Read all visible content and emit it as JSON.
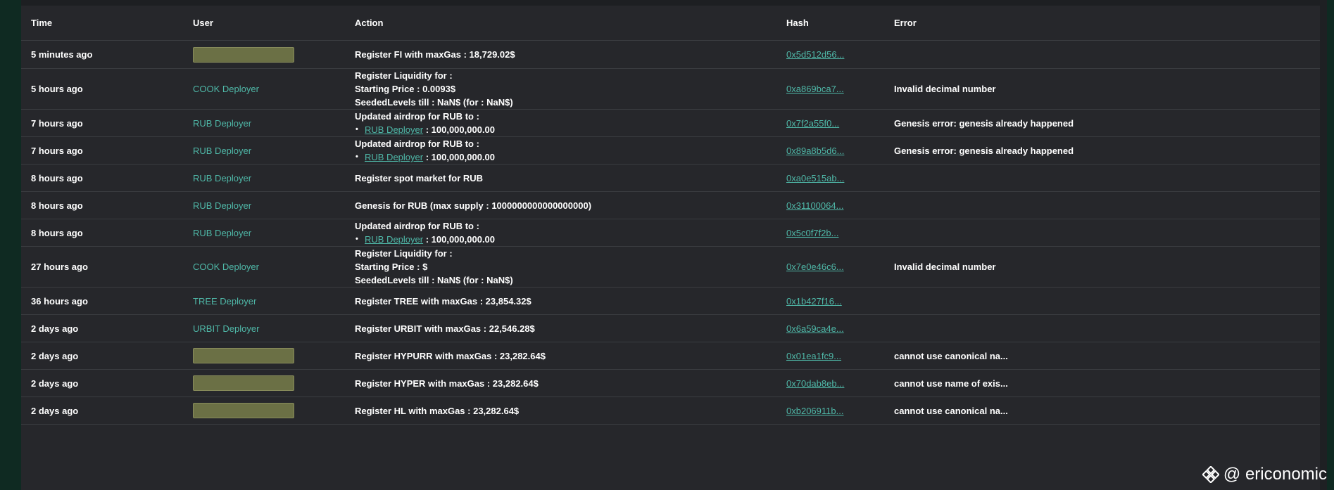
{
  "columns": {
    "time": "Time",
    "user": "User",
    "action": "Action",
    "hash": "Hash",
    "error": "Error"
  },
  "rows": [
    {
      "time": "5 minutes ago",
      "user": "",
      "user_redacted": true,
      "action": [
        "Register FI with maxGas : 18,729.02$"
      ],
      "hash": "0x5d512d56...",
      "error": ""
    },
    {
      "time": "5 hours ago",
      "user": "COOK Deployer",
      "action": [
        "Register Liquidity for :",
        "Starting Price : 0.0093$",
        "SeededLevels till : NaN$ (for : NaN$)"
      ],
      "hash": "0xa869bca7...",
      "error": "Invalid decimal number"
    },
    {
      "time": "7 hours ago",
      "user": "RUB Deployer",
      "action": [
        "Updated airdrop for RUB to :"
      ],
      "airdrop": {
        "link": "RUB Deployer",
        "amount": " : 100,000,000.00"
      },
      "hash": "0x7f2a55f0...",
      "error": "Genesis error: genesis already happened"
    },
    {
      "time": "7 hours ago",
      "user": "RUB Deployer",
      "action": [
        "Updated airdrop for RUB to :"
      ],
      "airdrop": {
        "link": "RUB Deployer",
        "amount": " : 100,000,000.00"
      },
      "hash": "0x89a8b5d6...",
      "error": "Genesis error: genesis already happened"
    },
    {
      "time": "8 hours ago",
      "user": "RUB Deployer",
      "action": [
        "Register spot market for RUB"
      ],
      "hash": "0xa0e515ab...",
      "error": ""
    },
    {
      "time": "8 hours ago",
      "user": "RUB Deployer",
      "action": [
        "Genesis for RUB (max supply : 1000000000000000000)"
      ],
      "hash": "0x31100064...",
      "error": ""
    },
    {
      "time": "8 hours ago",
      "user": "RUB Deployer",
      "action": [
        "Updated airdrop for RUB to :"
      ],
      "airdrop": {
        "link": "RUB Deployer",
        "amount": " : 100,000,000.00"
      },
      "hash": "0x5c0f7f2b...",
      "error": ""
    },
    {
      "time": "27 hours ago",
      "user": "COOK Deployer",
      "action": [
        "Register Liquidity for :",
        "Starting Price : $",
        "SeededLevels till : NaN$ (for : NaN$)"
      ],
      "hash": "0x7e0e46c6...",
      "error": "Invalid decimal number"
    },
    {
      "time": "36 hours ago",
      "user": "TREE Deployer",
      "action": [
        "Register TREE with maxGas : 23,854.32$"
      ],
      "hash": "0x1b427f16...",
      "error": ""
    },
    {
      "time": "2 days ago",
      "user": "URBIT Deployer",
      "action": [
        "Register URBIT with maxGas : 22,546.28$"
      ],
      "hash": "0x6a59ca4e...",
      "error": ""
    },
    {
      "time": "2 days ago",
      "user": "",
      "user_redacted": true,
      "action": [
        "Register HYPURR with maxGas : 23,282.64$"
      ],
      "hash": "0x01ea1fc9...",
      "error": "cannot use canonical na..."
    },
    {
      "time": "2 days ago",
      "user": "",
      "user_redacted": true,
      "action": [
        "Register HYPER with maxGas : 23,282.64$"
      ],
      "hash": "0x70dab8eb...",
      "error": "cannot use name of exis..."
    },
    {
      "time": "2 days ago",
      "user": "",
      "user_redacted": true,
      "action": [
        "Register HL with maxGas : 23,282.64$"
      ],
      "hash": "0xb206911b...",
      "error": "cannot use canonical na..."
    }
  ],
  "watermark": {
    "text": "@ ericonomic",
    "icon": "binance-logo-icon"
  },
  "colors": {
    "link": "#4fb8a8",
    "panel": "#26272b",
    "background": "#0f2a22",
    "redacted": "#6b7045"
  }
}
